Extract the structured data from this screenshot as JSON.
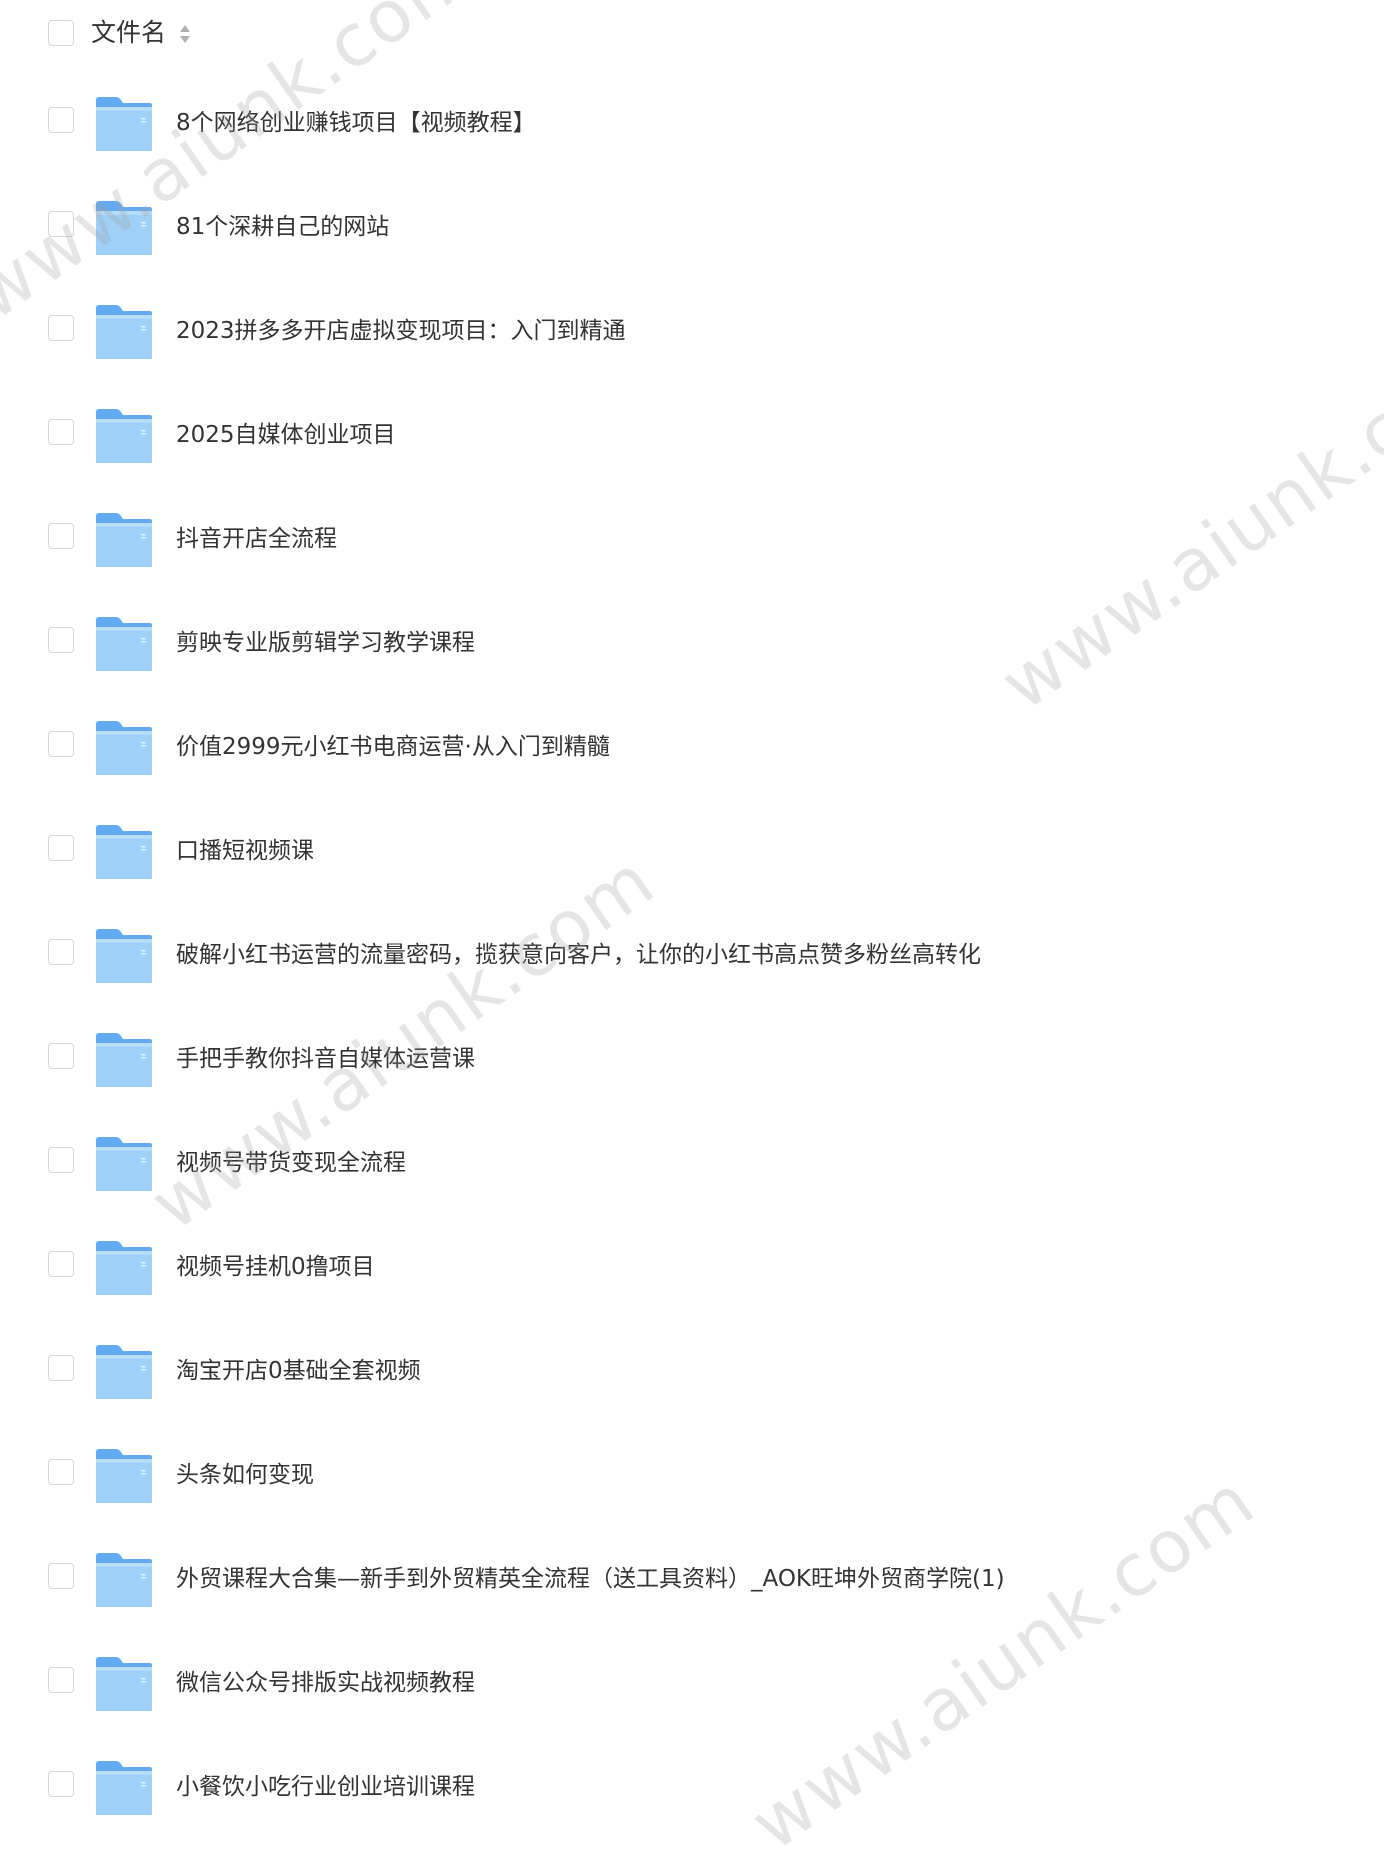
{
  "header": {
    "column_label": "文件名"
  },
  "files": [
    {
      "name": "8个网络创业赚钱项目【视频教程】"
    },
    {
      "name": "81个深耕自己的网站"
    },
    {
      "name": "2023拼多多开店虚拟变现项目：入门到精通"
    },
    {
      "name": "2025自媒体创业项目"
    },
    {
      "name": "抖音开店全流程"
    },
    {
      "name": "剪映专业版剪辑学习教学课程"
    },
    {
      "name": "价值2999元小红书电商运营·从入门到精髓"
    },
    {
      "name": "口播短视频课"
    },
    {
      "name": "破解小红书运营的流量密码，揽获意向客户，让你的小红书高点赞多粉丝高转化"
    },
    {
      "name": "手把手教你抖音自媒体运营课"
    },
    {
      "name": "视频号带货变现全流程"
    },
    {
      "name": "视频号挂机0撸项目"
    },
    {
      "name": "淘宝开店0基础全套视频"
    },
    {
      "name": "头条如何变现"
    },
    {
      "name": "外贸课程大合集—新手到外贸精英全流程（送工具资料）_AOK旺坤外贸商学院(1)"
    },
    {
      "name": "微信公众号排版实战视频教程"
    },
    {
      "name": "小餐饮小吃行业创业培训课程"
    }
  ],
  "watermarks": [
    {
      "text": "www.aiunk.com"
    },
    {
      "text": "www.aiunk.com"
    },
    {
      "text": "www.aiunk.com"
    },
    {
      "text": "www.aiunk.com"
    }
  ],
  "colors": {
    "folder_light": "#9fd0f7",
    "folder_dark": "#63aaf0",
    "checkbox_border": "#d6d6d6",
    "text": "#333333"
  }
}
